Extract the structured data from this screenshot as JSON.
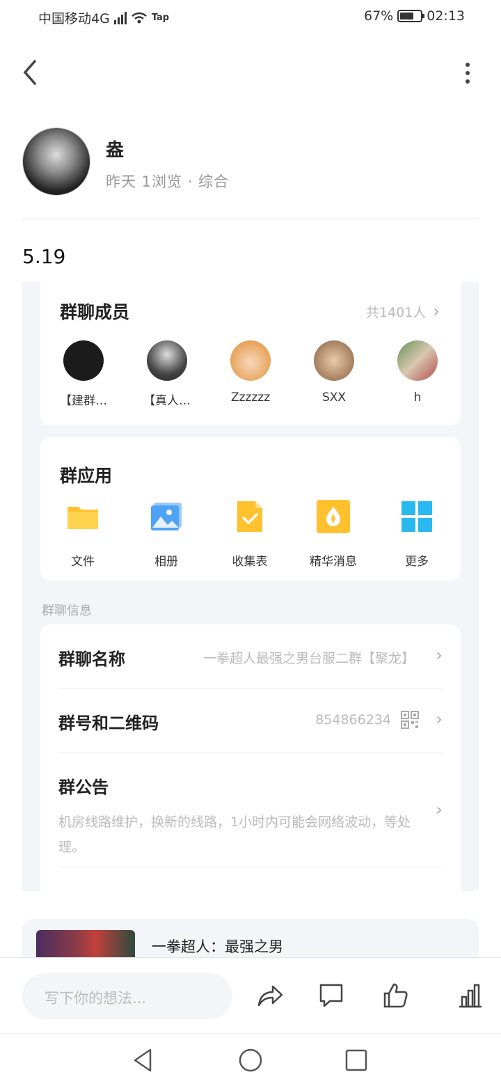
{
  "status_bar": {
    "carrier": "中国移动4G",
    "network": "4G",
    "tap": "Tap",
    "battery": "67%",
    "battery_level": 0.67,
    "time": "02:13"
  },
  "icons": {
    "back": "chevron-left-icon",
    "more": "more-vertical-icon"
  },
  "post": {
    "author": "盎",
    "meta": "昨天 1浏览 · 综合",
    "text": "5.19"
  },
  "group_members": {
    "title": "群聊成员",
    "count": "共1401人",
    "members": [
      {
        "name": "【建群…",
        "color": "#1b1b1b"
      },
      {
        "name": "【真人…",
        "color": "#2a2a2a"
      },
      {
        "name": "Zzzzzz",
        "color": "#e8a35a"
      },
      {
        "name": "SXX",
        "color": "#c9a27a"
      },
      {
        "name": "h",
        "color": "#a8b89a"
      }
    ]
  },
  "group_apps": {
    "title": "群应用",
    "apps": [
      {
        "label": "文件",
        "icon": "folder-icon",
        "color": "#ffc12e"
      },
      {
        "label": "相册",
        "icon": "photo-album-icon",
        "color": "#4fa3f7"
      },
      {
        "label": "收集表",
        "icon": "collect-form-icon",
        "color": "#ffc12e"
      },
      {
        "label": "精华消息",
        "icon": "essence-message-icon",
        "color": "#ffc12e"
      },
      {
        "label": "更多",
        "icon": "more-grid-icon",
        "color": "#2ab8f0"
      }
    ]
  },
  "group_info": {
    "section_label": "群聊信息",
    "name_label": "群聊名称",
    "name_value": "一拳超人最强之男台服二群【聚龙】",
    "number_label": "群号和二维码",
    "number_value": "854866234",
    "notice_label": "群公告",
    "notice_text": "机房线路维护，换新的线路，1小时内可能会网络波动，等处理。"
  },
  "link_card": {
    "title": "一拳超人：最强之男"
  },
  "comment_bar": {
    "placeholder": "写下你的想法..."
  }
}
